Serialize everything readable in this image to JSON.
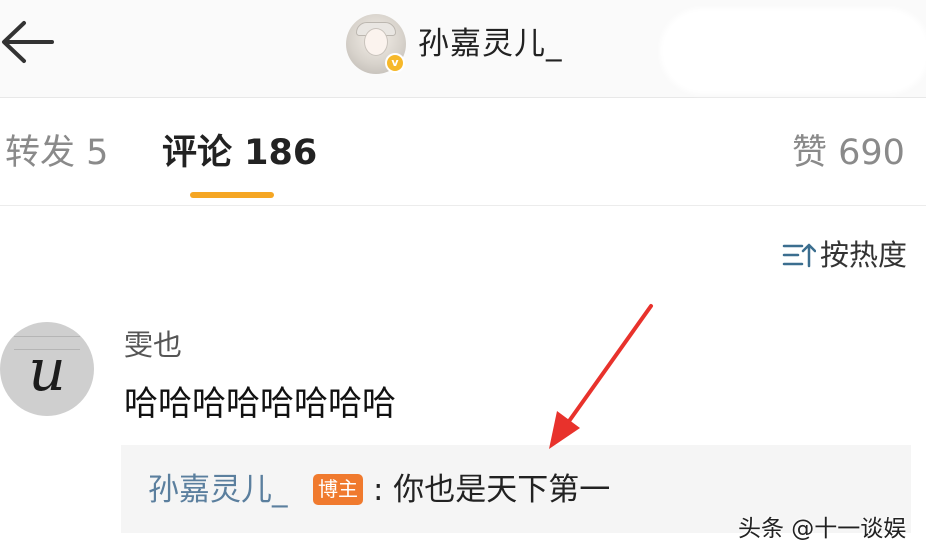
{
  "header": {
    "title": "孙嘉灵儿_",
    "back_icon": "arrow-left-icon",
    "verified_icon": "verified-badge-icon",
    "verified_color": "#f6b82a"
  },
  "tabs": {
    "repost": "转发 5",
    "comment": "评论 186",
    "like": "赞 690",
    "active": "comment",
    "indicator_color": "#f5a623"
  },
  "sort": {
    "icon": "sort-icon",
    "label": "按热度"
  },
  "comment": {
    "avatar_letter": "u",
    "username": "雯也",
    "text": "哈哈哈哈哈哈哈哈",
    "reply": {
      "username": "孙嘉灵儿_",
      "badge": "博主",
      "badge_color": "#f07a2e",
      "text": ": 你也是天下第一"
    }
  },
  "annotation": {
    "arrow_color": "#e8322c"
  },
  "watermark": "头条 @十一谈娱"
}
